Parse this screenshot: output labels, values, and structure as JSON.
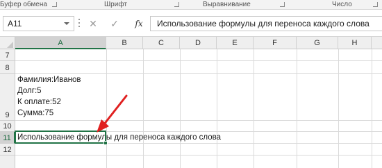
{
  "ribbon": {
    "groups": [
      "Буфер обмена",
      "Шрифт",
      "Выравнивание",
      "Число"
    ]
  },
  "formula_bar": {
    "name_box": "A11",
    "cancel_glyph": "✕",
    "enter_glyph": "✓",
    "fx_label": "fx",
    "formula": "Использование формулы для переноса каждого слова"
  },
  "grid": {
    "columns": [
      "A",
      "B",
      "C",
      "D",
      "E",
      "F",
      "G",
      "H"
    ],
    "selected_column": "A",
    "rows": [
      "7",
      "8",
      "9",
      "10",
      "11",
      "12"
    ],
    "selected_row": "11",
    "cell_a9_lines": [
      "Фамилия:Иванов",
      "Долг:5",
      "К оплате:52",
      "Сумма:75"
    ],
    "cell_a11": "Использование формулы для переноса каждого слова"
  },
  "annotation": {
    "arrow_color": "#e02020"
  },
  "colors": {
    "accent": "#217346"
  }
}
